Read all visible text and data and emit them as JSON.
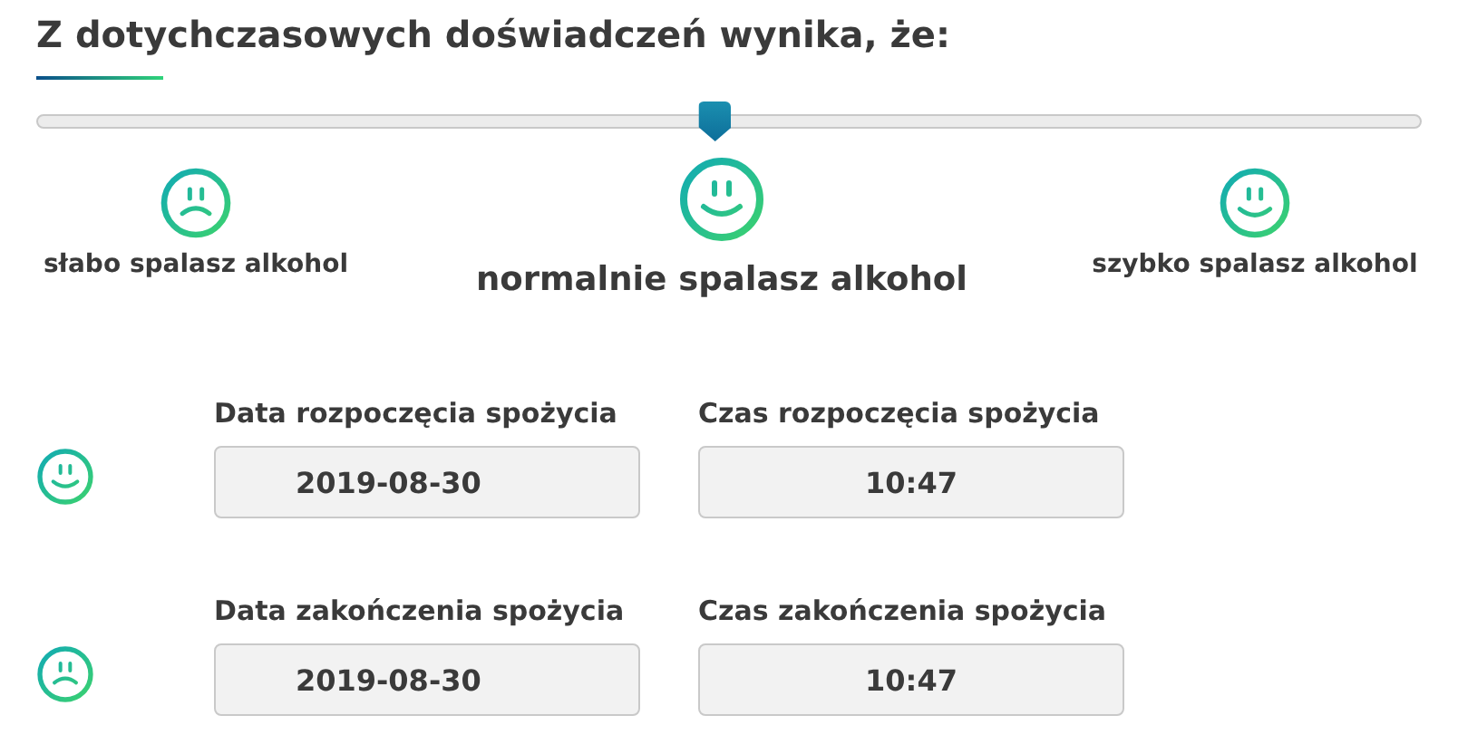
{
  "title": "Z dotychczasowych doświadczeń wynika, że:",
  "slider": {
    "level": 0.49
  },
  "options": [
    {
      "label": "słabo spalasz alkohol",
      "kind": "sad",
      "selected": false
    },
    {
      "label": "normalnie spalasz alkohol",
      "kind": "smile",
      "selected": true
    },
    {
      "label": "szybko spalasz alkohol",
      "kind": "smile",
      "selected": false
    }
  ],
  "rows": [
    {
      "kind": "smile",
      "fields": [
        {
          "label": "Data rozpoczęcia spożycia",
          "value": "2019-08-30",
          "kind": "date"
        },
        {
          "label": "Czas rozpoczęcia spożycia",
          "value": "10:47",
          "kind": "time"
        }
      ]
    },
    {
      "kind": "sad",
      "fields": [
        {
          "label": "Data zakończenia spożycia",
          "value": "2019-08-30",
          "kind": "date"
        },
        {
          "label": "Czas zakończenia spożycia",
          "value": "10:47",
          "kind": "time"
        }
      ]
    }
  ]
}
